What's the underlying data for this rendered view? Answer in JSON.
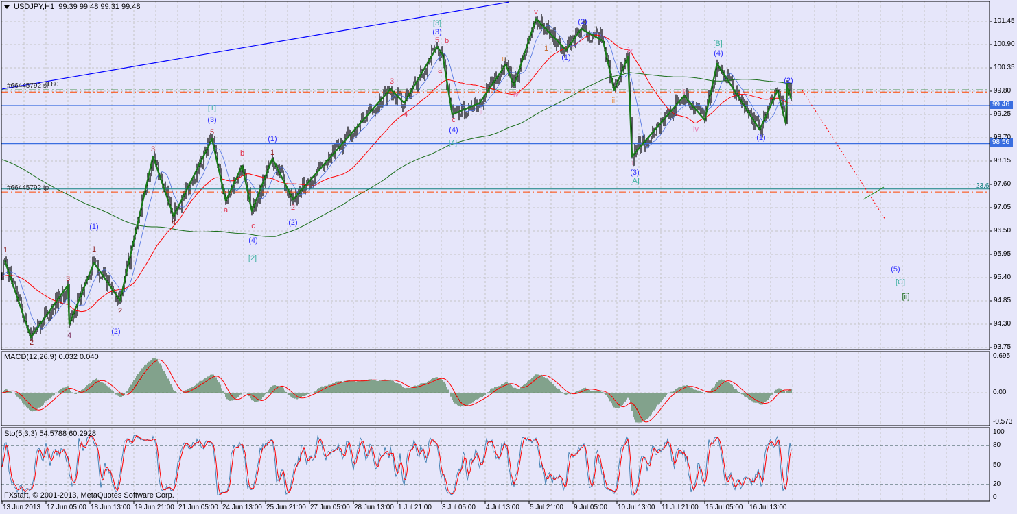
{
  "header": {
    "symbol": "USDJPY,H1",
    "ohlc": "99.39 99.48 99.31 99.48"
  },
  "macd_header": "MACD(12,26,9) 0.032 0.040",
  "sto_header": "Sto(5,3,3) 54.5788 60.2928",
  "footer": "FXstart, © 2001-2013, MetaQuotes Software Corp.",
  "order_labels": {
    "sl": "#66445792 sl",
    "sl_fibo": "0.80",
    "tp": "#66445792 tp",
    "fibo": "23.6"
  },
  "price_badges": [
    "99.46",
    "98.56"
  ],
  "colors": {
    "background": "#e6e6fa",
    "bars": "#000000",
    "zigzag": "#1a7a1a",
    "ma_fast": "#4a6fe0",
    "ma_mid": "#ff0000",
    "ma_slow": "#1a6e1a",
    "badge": "#3a6ee0",
    "macd_hist": "#1f5f1f",
    "signal": "#ff0000",
    "sto_main": "#4682b4"
  },
  "chart_data": {
    "type": "line",
    "title": "USDJPY,H1",
    "ylim": [
      93.75,
      101.45
    ],
    "y_ticks": [
      "101.45",
      "100.90",
      "100.35",
      "99.80",
      "99.25",
      "98.70",
      "98.15",
      "97.60",
      "97.05",
      "96.50",
      "95.95",
      "95.40",
      "94.85",
      "94.30",
      "93.75"
    ],
    "x_ticks": [
      {
        "label": "13 Jun 2013",
        "bar": 0
      },
      {
        "label": "17 Jun 05:00",
        "bar": 32
      },
      {
        "label": "18 Jun 13:00",
        "bar": 64
      },
      {
        "label": "19 Jun 21:00",
        "bar": 96
      },
      {
        "label": "21 Jun 05:00",
        "bar": 128
      },
      {
        "label": "24 Jun 13:00",
        "bar": 160
      },
      {
        "label": "25 Jun 21:00",
        "bar": 192
      },
      {
        "label": "27 Jun 05:00",
        "bar": 224
      },
      {
        "label": "28 Jun 13:00",
        "bar": 256
      },
      {
        "label": "1 Jul 21:00",
        "bar": 288
      },
      {
        "label": "3 Jul 05:00",
        "bar": 320
      },
      {
        "label": "4 Jul 13:00",
        "bar": 352
      },
      {
        "label": "5 Jul 21:00",
        "bar": 384
      },
      {
        "label": "9 Jul 05:00",
        "bar": 416
      },
      {
        "label": "10 Jul 13:00",
        "bar": 448
      },
      {
        "label": "11 Jul 21:00",
        "bar": 480
      },
      {
        "label": "15 Jul 05:00",
        "bar": 512
      },
      {
        "label": "16 Jul 13:00",
        "bar": 544
      }
    ],
    "zigzag": [
      [
        2,
        95.8
      ],
      [
        21,
        93.99
      ],
      [
        48,
        95.22
      ],
      [
        49,
        94.3
      ],
      [
        67,
        95.75
      ],
      [
        86,
        94.86
      ],
      [
        110,
        98.26
      ],
      [
        125,
        96.85
      ],
      [
        153,
        98.67
      ],
      [
        163,
        97.21
      ],
      [
        175,
        98.04
      ],
      [
        182,
        96.97
      ],
      [
        197,
        98.21
      ],
      [
        212,
        97.24
      ],
      [
        283,
        99.85
      ],
      [
        293,
        99.52
      ],
      [
        317,
        100.85
      ],
      [
        321,
        100.66
      ],
      [
        328,
        99.25
      ],
      [
        348,
        99.52
      ],
      [
        367,
        100.43
      ],
      [
        373,
        99.93
      ],
      [
        389,
        101.51
      ],
      [
        411,
        100.77
      ],
      [
        422,
        101.27
      ],
      [
        438,
        100.98
      ],
      [
        446,
        99.82
      ],
      [
        456,
        100.61
      ],
      [
        459,
        98.26
      ],
      [
        497,
        99.69
      ],
      [
        512,
        99.12
      ],
      [
        521,
        100.45
      ],
      [
        552,
        98.89
      ],
      [
        565,
        99.82
      ],
      [
        571,
        99.04
      ],
      [
        572,
        99.95
      ],
      [
        575,
        99.61
      ]
    ],
    "levels": [
      {
        "name": "hline-1",
        "price": 99.46
      },
      {
        "name": "hline-2",
        "price": 98.56
      },
      {
        "name": "sl",
        "price": 99.78
      },
      {
        "name": "sl-green",
        "price": 99.83
      },
      {
        "name": "tp",
        "price": 97.42
      },
      {
        "name": "fibo-23.6",
        "price": 97.49
      }
    ],
    "trendline": [
      [
        0,
        99.85
      ],
      [
        369,
        101.9
      ]
    ],
    "projection": [
      [
        583,
        99.82
      ],
      [
        643,
        96.8
      ]
    ],
    "wave_labels": [
      {
        "t": "1",
        "b": 2.5,
        "p": 96.05,
        "c": "#8b1a1a"
      },
      {
        "t": "2",
        "b": 21.5,
        "p": 93.87,
        "c": "#8b1a1a"
      },
      {
        "t": "3",
        "b": 48,
        "p": 95.37,
        "c": "#c0282d"
      },
      {
        "t": "4",
        "b": 49,
        "p": 94.02,
        "c": "#7a2a5a"
      },
      {
        "t": "1",
        "b": 67,
        "p": 96.07,
        "c": "#8b1a1a"
      },
      {
        "t": "(1)",
        "b": 67,
        "p": 96.59,
        "c": "#3030ff"
      },
      {
        "t": "2",
        "b": 86,
        "p": 94.6,
        "c": "#8b1a1a"
      },
      {
        "t": "(2)",
        "b": 83,
        "p": 94.12,
        "c": "#3030ff"
      },
      {
        "t": "3",
        "b": 110,
        "p": 98.43,
        "c": "#c0282d"
      },
      {
        "t": "4",
        "b": 125,
        "p": 96.7,
        "c": "#8b1a1a"
      },
      {
        "t": "5",
        "b": 153,
        "p": 98.83,
        "c": "#c0282d"
      },
      {
        "t": "(3)",
        "b": 153,
        "p": 99.12,
        "c": "#3030ff"
      },
      {
        "t": "[1]",
        "b": 153,
        "p": 99.4,
        "c": "#3cb0a0"
      },
      {
        "t": "b",
        "b": 175,
        "p": 98.33,
        "c": "#e0304a"
      },
      {
        "t": "a",
        "b": 163,
        "p": 96.99,
        "c": "#e0304a"
      },
      {
        "t": "c",
        "b": 183,
        "p": 96.61,
        "c": "#e0304a"
      },
      {
        "t": "(4)",
        "b": 183,
        "p": 96.27,
        "c": "#3030ff"
      },
      {
        "t": "[2]",
        "b": 182.5,
        "p": 95.85,
        "c": "#3cb0a0"
      },
      {
        "t": "(1)",
        "b": 197,
        "p": 98.67,
        "c": "#3030ff"
      },
      {
        "t": "1",
        "b": 197,
        "p": 98.35,
        "c": "#8b1a1a"
      },
      {
        "t": "2",
        "b": 212,
        "p": 97.05,
        "c": "#e0304a"
      },
      {
        "t": "(2)",
        "b": 212,
        "p": 96.69,
        "c": "#3030ff"
      },
      {
        "t": "3",
        "b": 284,
        "p": 100.03,
        "c": "#e0304a"
      },
      {
        "t": "4",
        "b": 294,
        "p": 99.25,
        "c": "#e0304a"
      },
      {
        "t": "5",
        "b": 317,
        "p": 101.0,
        "c": "#e0304a"
      },
      {
        "t": "(3)",
        "b": 317,
        "p": 101.19,
        "c": "#3030ff"
      },
      {
        "t": "[3]",
        "b": 317,
        "p": 101.4,
        "c": "#3cb0a0"
      },
      {
        "t": "b",
        "b": 324,
        "p": 100.98,
        "c": "#e0304a"
      },
      {
        "t": "a",
        "b": 319,
        "p": 100.29,
        "c": "#e0304a"
      },
      {
        "t": "c",
        "b": 329,
        "p": 99.12,
        "c": "#e0304a"
      },
      {
        "t": "(4)",
        "b": 329,
        "p": 98.88,
        "c": "#3030ff"
      },
      {
        "t": "[4]",
        "b": 328.5,
        "p": 98.57,
        "c": "#3cb0a0"
      },
      {
        "t": "ii",
        "b": 349,
        "p": 99.31,
        "c": "#e87ab0"
      },
      {
        "t": "iii",
        "b": 366,
        "p": 100.56,
        "c": "#e89a5a"
      },
      {
        "t": "iv",
        "b": 374.5,
        "p": 99.72,
        "c": "#e87ab0"
      },
      {
        "t": "v",
        "b": 389,
        "p": 101.66,
        "c": "#e0304a"
      },
      {
        "t": "1",
        "b": 396.5,
        "p": 100.81,
        "c": "#c06020"
      },
      {
        "t": "(1)",
        "b": 411,
        "p": 100.6,
        "c": "#3030ff"
      },
      {
        "t": "(2)",
        "b": 423,
        "p": 101.43,
        "c": "#3030ff"
      },
      {
        "t": "iii",
        "b": 446,
        "p": 99.58,
        "c": "#e89a5a"
      },
      {
        "t": "iv",
        "b": 457.5,
        "p": 100.76,
        "c": "#e87ab0"
      },
      {
        "t": "i",
        "b": 459.5,
        "p": 98.1,
        "c": "#e87ab0"
      },
      {
        "t": "(3)",
        "b": 461,
        "p": 97.87,
        "c": "#3030ff"
      },
      {
        "t": "[A]",
        "b": 461,
        "p": 97.68,
        "c": "#3cb0a0"
      },
      {
        "t": "ii",
        "b": 497.5,
        "p": 99.77,
        "c": "#e87ab0"
      },
      {
        "t": "iv",
        "b": 505.5,
        "p": 98.89,
        "c": "#e87ab0"
      },
      {
        "t": "[B]",
        "b": 521.5,
        "p": 100.92,
        "c": "#3cb0a0"
      },
      {
        "t": "(4)",
        "b": 522,
        "p": 100.69,
        "c": "#3030ff"
      },
      {
        "t": "(1)",
        "b": 553,
        "p": 98.7,
        "c": "#3030ff"
      },
      {
        "t": "(2)",
        "b": 573,
        "p": 100.05,
        "c": "#3030ff"
      },
      {
        "t": "(5)",
        "b": 651,
        "p": 95.59,
        "c": "#3030ff"
      },
      {
        "t": "[C]",
        "b": 654.5,
        "p": 95.29,
        "c": "#3cb0a0"
      },
      {
        "t": "[ii]",
        "b": 658.5,
        "p": 94.95,
        "c": "#1a6e1a"
      }
    ],
    "macd": {
      "params": [
        12,
        26,
        9
      ],
      "ylim": [
        -0.573,
        0.695
      ],
      "ticks": [
        "0.695",
        "0.00",
        "-0.573"
      ]
    },
    "stochastic": {
      "params": [
        5,
        3,
        3
      ],
      "ylim": [
        0,
        100
      ],
      "ticks": [
        "100",
        "80",
        "50",
        "20",
        "0"
      ],
      "levels": [
        80,
        50,
        20
      ]
    }
  }
}
